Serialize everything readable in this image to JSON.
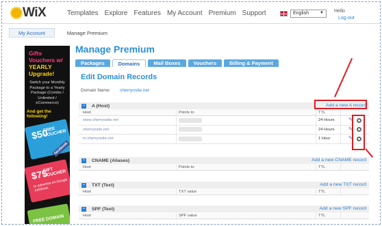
{
  "header": {
    "logo_text": "WiX",
    "nav": [
      "Templates",
      "Explore",
      "Features",
      "My Account",
      "Premium",
      "Support"
    ],
    "language": "English",
    "hello": "Hello",
    "logout": "Log-out"
  },
  "breadcrumb": {
    "root": "My Account",
    "current": "Manage Premium"
  },
  "sidebar_ad": {
    "title_line1": "Gifts Vouchers w/",
    "title_line2": "YEARLY Upgrade!",
    "body": "Switch your Monthly Package to a Yearly Package (Combo / Unlimited / eCommerce)",
    "cta": "And get the following!",
    "card1_amount": "$50",
    "card1_label": "FREE VOUCHER",
    "card1_tag": "facebook",
    "card2_amount": "$75",
    "card2_label": "GIFT VOUCHER",
    "card2_sub": "to advertise on Google AdWords",
    "card3_label": "FREE DOMAIN"
  },
  "page": {
    "title": "Manage Premium",
    "tabs": [
      "Packages",
      "Domains",
      "Mail Boxes",
      "Vouchers",
      "Billing & Payment"
    ],
    "active_tab": "Domains",
    "section_title": "Edit Domain Records",
    "domain_label": "Domain Name:",
    "domain_value": "cherryosite.net"
  },
  "records": {
    "a": {
      "title": "A (Host)",
      "add": "Add a new A record",
      "headers": [
        "Host",
        "Points to",
        "TTL"
      ],
      "rows": [
        {
          "host": "www.cherryosite.net",
          "ttl": "24 Hours"
        },
        {
          "host": "cherryosite.net",
          "ttl": "24 Hours"
        },
        {
          "host": "m.cherryosite.net",
          "ttl": "1 Hour"
        }
      ]
    },
    "cname": {
      "title": "CNAME (Aliases)",
      "add": "Add a new CNAME record",
      "headers": [
        "Host",
        "Points to",
        "TTL"
      ]
    },
    "txt": {
      "title": "TXT (Text)",
      "add": "Add a new TXT record",
      "headers": [
        "Host",
        "TXT value",
        "TTL"
      ]
    },
    "spf": {
      "title": "SPF (Text)",
      "add": "Add a new SPF record",
      "headers": [
        "Host",
        "SPF value",
        "TTL"
      ]
    }
  },
  "colors": {
    "accent": "#2a8fd8",
    "highlight": "#e4161c",
    "tab": "#5aa8e0"
  },
  "icons": [
    "edit-pencil-icon",
    "settings-gear-icon",
    "minus-icon",
    "flag-uk-icon"
  ]
}
